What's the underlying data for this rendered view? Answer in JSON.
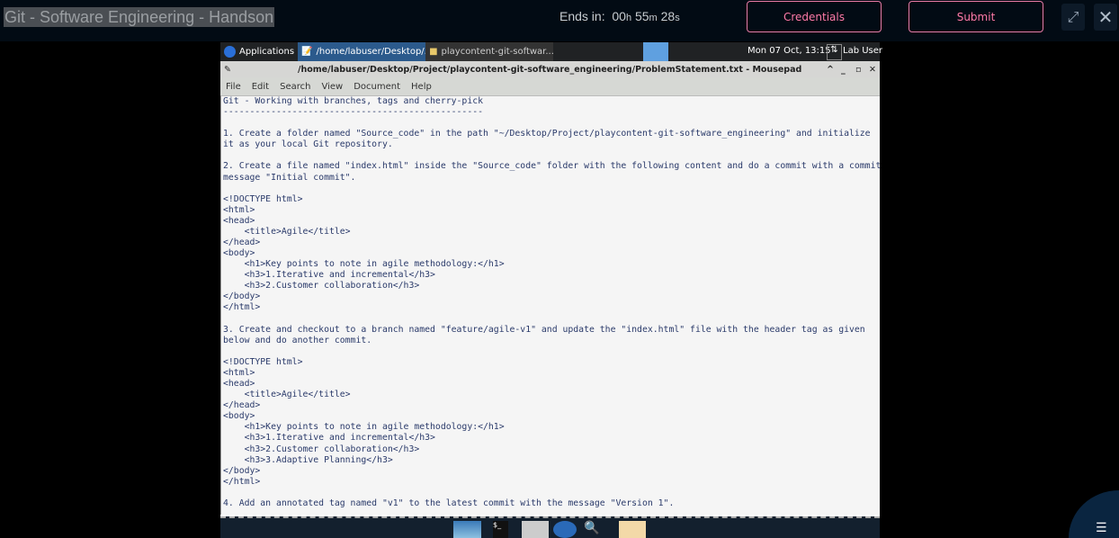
{
  "header": {
    "title": "Git - Software Engineering - Handson",
    "timer_label": "Ends in:",
    "hours": "00",
    "minutes": "55",
    "seconds": "28",
    "h": "h",
    "m": "m",
    "s": "s",
    "credentials_label": "Credentials",
    "submit_label": "Submit",
    "accent": "#ff7aa8"
  },
  "panel": {
    "applications": "Applications",
    "task1": "/home/labuser/Desktop/...",
    "task2": "playcontent-git-softwar...",
    "clock": "Mon 07 Oct, 13:15",
    "user": "Lab User"
  },
  "window": {
    "title": "/home/labuser/Desktop/Project/playcontent-git-software_engineering/ProblemStatement.txt - Mousepad"
  },
  "menu": [
    "File",
    "Edit",
    "Search",
    "View",
    "Document",
    "Help"
  ],
  "lines": [
    "Git - Working with branches, tags and cherry-pick",
    "-------------------------------------------------",
    "",
    "1. Create a folder named \"Source_code\" in the path \"~/Desktop/Project/playcontent-git-software_engineering\" and initialize",
    "it as your local Git repository.",
    "",
    "2. Create a file named \"index.html\" inside the \"Source_code\" folder with the following content and do a commit with a commit",
    "message \"Initial commit\".",
    "",
    "<!DOCTYPE html>",
    "<html>",
    "<head>",
    "    <title>Agile</title>",
    "</head>",
    "<body>",
    "    <h1>Key points to note in agile methodology:</h1>",
    "    <h3>1.Iterative and incremental</h3>",
    "    <h3>2.Customer collaboration</h3>",
    "</body>",
    "</html>",
    "",
    "3. Create and checkout to a branch named \"feature/agile-v1\" and update the \"index.html\" file with the header tag as given",
    "below and do another commit.",
    "",
    "<!DOCTYPE html>",
    "<html>",
    "<head>",
    "    <title>Agile</title>",
    "</head>",
    "<body>",
    "    <h1>Key points to note in agile methodology:</h1>",
    "    <h3>1.Iterative and incremental</h3>",
    "    <h3>2.Customer collaboration</h3>",
    "    <h3>3.Adaptive Planning</h3>",
    "</body>",
    "</html>",
    "",
    "4. Add an annotated tag named \"v1\" to the latest commit with the message \"Version 1\"."
  ]
}
